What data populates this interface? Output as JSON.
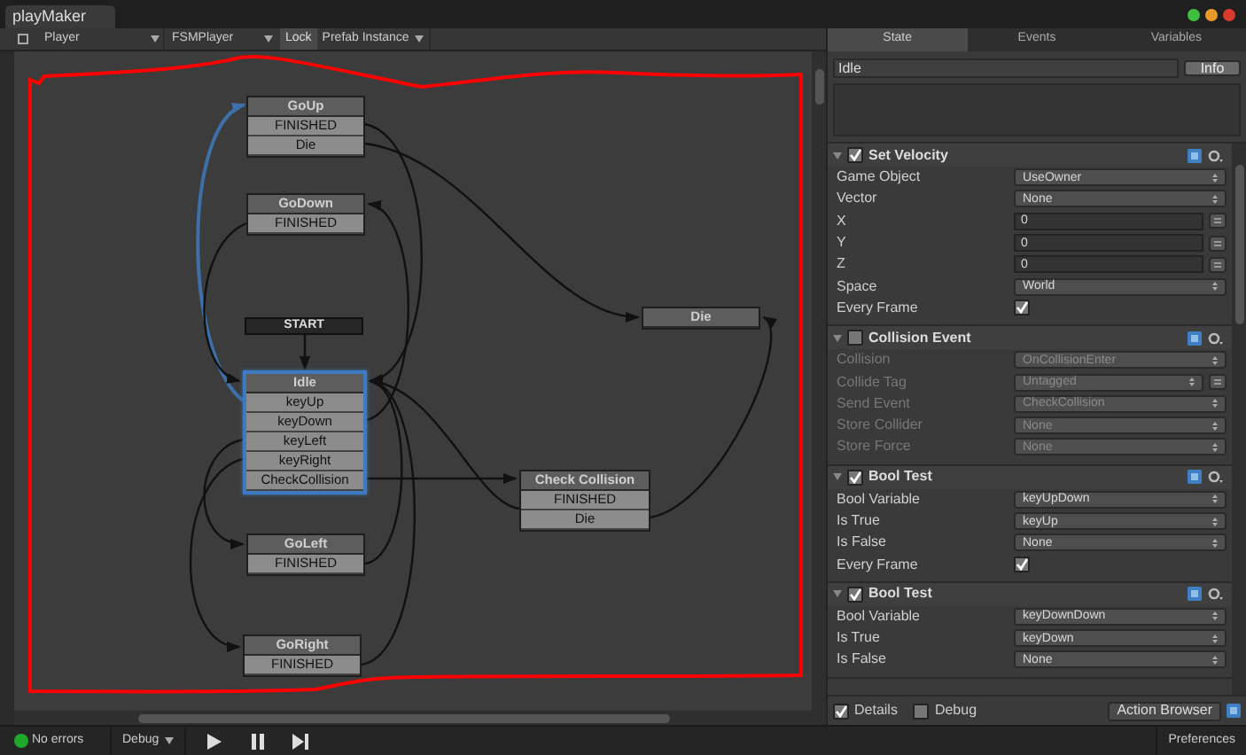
{
  "window": {
    "tab": "playMaker"
  },
  "toolbar": {
    "game_object": "Player",
    "fsm": "FSMPlayer",
    "lock": "Lock",
    "prefab": "Prefab Instance"
  },
  "graph": {
    "start": "START",
    "states": [
      {
        "name": "GoUp",
        "selected": false,
        "events": [
          "FINISHED",
          "Die"
        ]
      },
      {
        "name": "GoDown",
        "selected": false,
        "events": [
          "FINISHED"
        ]
      },
      {
        "name": "Die",
        "selected": false
      },
      {
        "name": "Idle",
        "selected": true,
        "events": [
          "keyUp",
          "keyDown",
          "keyLeft",
          "keyRight",
          "CheckCollision"
        ]
      },
      {
        "name": "Check Collision",
        "selected": false,
        "events": [
          "FINISHED",
          "Die"
        ]
      },
      {
        "name": "GoLeft",
        "selected": false,
        "events": [
          "FINISHED"
        ]
      },
      {
        "name": "GoRight",
        "selected": false,
        "events": [
          "FINISHED"
        ]
      }
    ]
  },
  "inspector": {
    "tabs": [
      {
        "label": "State",
        "selected": true
      },
      {
        "label": "Events",
        "selected": false
      },
      {
        "label": "Variables",
        "selected": false
      }
    ],
    "state_name": "Idle",
    "info_button": "Info",
    "actions": [
      {
        "title": "Set Velocity",
        "enabled": true,
        "fields": [
          {
            "label": "Game Object",
            "kind": "dropdown",
            "value": "UseOwner"
          },
          {
            "label": "Vector",
            "kind": "dropdown",
            "value": "None"
          },
          {
            "label": "X",
            "kind": "number",
            "value": "0"
          },
          {
            "label": "Y",
            "kind": "number",
            "value": "0"
          },
          {
            "label": "Z",
            "kind": "number",
            "value": "0"
          },
          {
            "label": "Space",
            "kind": "dropdown",
            "value": "World"
          },
          {
            "label": "Every Frame",
            "kind": "checkbox",
            "checked": true
          }
        ]
      },
      {
        "title": "Collision Event",
        "enabled": false,
        "fields": [
          {
            "label": "Collision",
            "kind": "dropdown",
            "value": "OnCollisionEnter"
          },
          {
            "label": "Collide Tag",
            "kind": "dropdown_toggle",
            "value": "Untagged"
          },
          {
            "label": "Send Event",
            "kind": "dropdown",
            "value": "CheckCollision"
          },
          {
            "label": "Store Collider",
            "kind": "dropdown",
            "value": "None"
          },
          {
            "label": "Store Force",
            "kind": "dropdown",
            "value": "None"
          }
        ]
      },
      {
        "title": "Bool Test",
        "enabled": true,
        "fields": [
          {
            "label": "Bool Variable",
            "kind": "dropdown",
            "value": "keyUpDown"
          },
          {
            "label": "Is True",
            "kind": "dropdown",
            "value": "keyUp"
          },
          {
            "label": "Is False",
            "kind": "dropdown",
            "value": "None"
          },
          {
            "label": "Every Frame",
            "kind": "checkbox",
            "checked": true
          }
        ]
      },
      {
        "title": "Bool Test",
        "enabled": true,
        "fields": [
          {
            "label": "Bool Variable",
            "kind": "dropdown",
            "value": "keyDownDown"
          },
          {
            "label": "Is True",
            "kind": "dropdown",
            "value": "keyDown"
          },
          {
            "label": "Is False",
            "kind": "dropdown",
            "value": "None"
          }
        ]
      }
    ],
    "footer": {
      "details": {
        "label": "Details",
        "checked": true
      },
      "debug": {
        "label": "Debug",
        "checked": false
      },
      "action_browser": "Action Browser"
    }
  },
  "status_bar": {
    "errors": "No errors",
    "debug": "Debug",
    "preferences": "Preferences"
  }
}
